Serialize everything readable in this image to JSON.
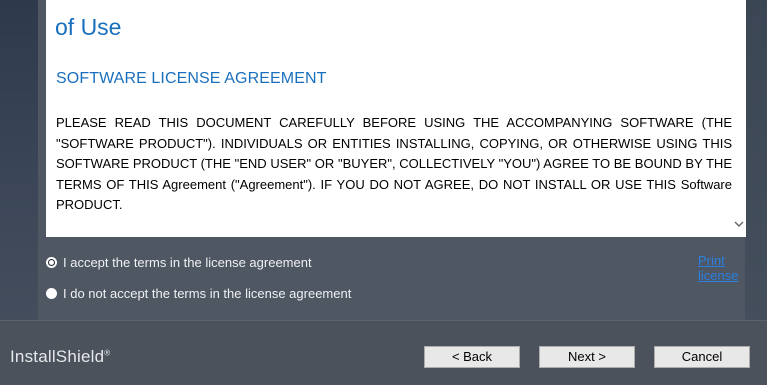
{
  "license": {
    "heading": "of Use",
    "subheading": "SOFTWARE LICENSE AGREEMENT",
    "body": "PLEASE READ THIS DOCUMENT CAREFULLY BEFORE USING THE ACCOMPANYING SOFTWARE (THE \"SOFTWARE PRODUCT\"). INDIVIDUALS OR ENTITIES INSTALLING, COPYING, OR OTHERWISE USING THIS SOFTWARE PRODUCT (THE \"END USER\" OR \"BUYER\", COLLECTIVELY \"YOU\") AGREE TO BE BOUND BY THE TERMS OF THIS Agreement (\"Agreement\"). IF YOU DO NOT AGREE, DO NOT INSTALL OR USE THIS Software PRODUCT."
  },
  "options": {
    "accept_label": "I accept the terms in the license agreement",
    "decline_label": "I do not accept the terms in the license agreement",
    "selected": "accept"
  },
  "print_link": "Print license",
  "footer": {
    "brand": "InstallShield",
    "brand_mark": "®",
    "back_label": "< Back",
    "next_label": "Next >",
    "cancel_label": "Cancel"
  },
  "colors": {
    "heading_blue": "#1a6fbd",
    "link_blue": "#2a7fe0",
    "panel_bg": "#4f5762"
  },
  "icons": {
    "scroll": "chevron-down-icon"
  }
}
